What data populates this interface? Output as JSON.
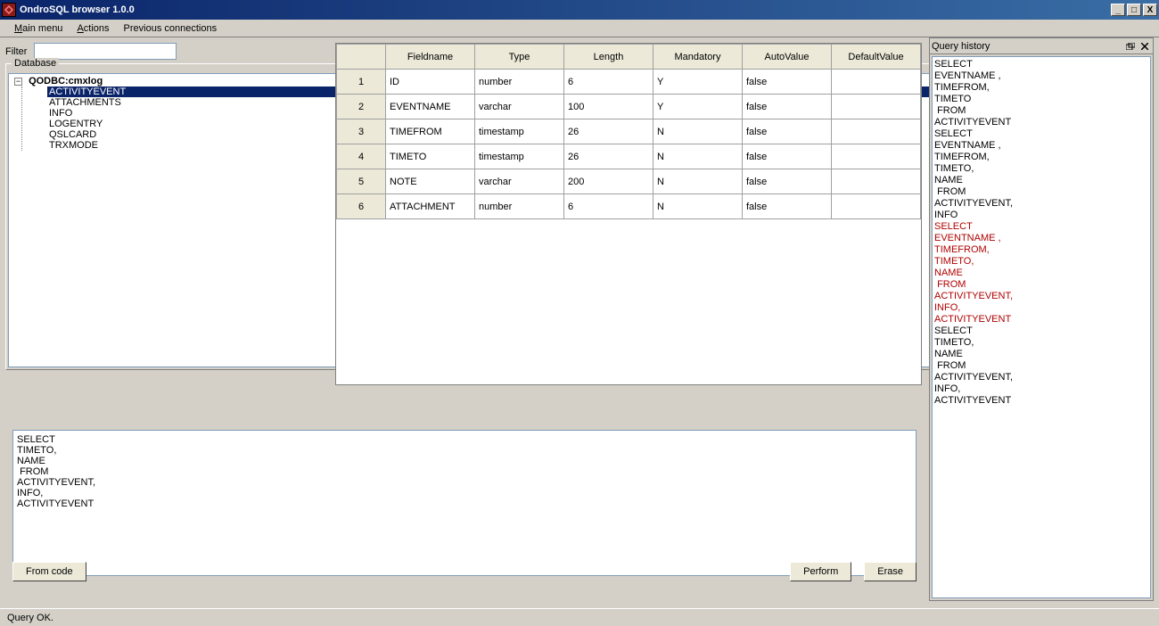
{
  "window": {
    "title": "OndroSQL browser 1.0.0"
  },
  "menu": {
    "main_menu": "Main menu",
    "actions": "Actions",
    "previous_connections": "Previous connections"
  },
  "filter": {
    "label": "Filter",
    "value": ""
  },
  "database": {
    "group_label": "Database",
    "root": "QODBC:cmxlog",
    "selected": "ACTIVITYEVENT",
    "children": [
      "ACTIVITYEVENT",
      "ATTACHMENTS",
      "INFO",
      "LOGENTRY",
      "QSLCARD",
      "TRXMODE"
    ]
  },
  "columns_table": {
    "headers": [
      "Fieldname",
      "Type",
      "Length",
      "Mandatory",
      "AutoValue",
      "DefaultValue"
    ],
    "rows": [
      {
        "n": "1",
        "fieldname": "ID",
        "type": "number",
        "length": "6",
        "mandatory": "Y",
        "autovalue": "false",
        "defaultvalue": ""
      },
      {
        "n": "2",
        "fieldname": "EVENTNAME",
        "type": "varchar",
        "length": "100",
        "mandatory": "Y",
        "autovalue": "false",
        "defaultvalue": ""
      },
      {
        "n": "3",
        "fieldname": "TIMEFROM",
        "type": "timestamp",
        "length": "26",
        "mandatory": "N",
        "autovalue": "false",
        "defaultvalue": ""
      },
      {
        "n": "4",
        "fieldname": "TIMETO",
        "type": "timestamp",
        "length": "26",
        "mandatory": "N",
        "autovalue": "false",
        "defaultvalue": ""
      },
      {
        "n": "5",
        "fieldname": "NOTE",
        "type": "varchar",
        "length": "200",
        "mandatory": "N",
        "autovalue": "false",
        "defaultvalue": ""
      },
      {
        "n": "6",
        "fieldname": "ATTACHMENT",
        "type": "number",
        "length": "6",
        "mandatory": "N",
        "autovalue": "false",
        "defaultvalue": ""
      }
    ]
  },
  "query": "SELECT\nTIMETO,\nNAME\n FROM\nACTIVITYEVENT,\nINFO,\nACTIVITYEVENT",
  "buttons": {
    "from_code": "From code",
    "perform": "Perform",
    "erase": "Erase"
  },
  "history": {
    "title": "Query history",
    "entries": [
      {
        "text": "SELECT\nEVENTNAME ,\nTIMEFROM,\nTIMETO\n FROM\nACTIVITYEVENT",
        "error": false
      },
      {
        "text": "SELECT\nEVENTNAME ,\nTIMEFROM,\nTIMETO,\nNAME\n FROM\nACTIVITYEVENT,\nINFO",
        "error": false
      },
      {
        "text": "SELECT\nEVENTNAME ,\nTIMEFROM,\nTIMETO,\nNAME\n FROM\nACTIVITYEVENT,\nINFO,\nACTIVITYEVENT",
        "error": true
      },
      {
        "text": "SELECT\nTIMETO,\nNAME\n FROM\nACTIVITYEVENT,\nINFO,\nACTIVITYEVENT",
        "error": false
      }
    ]
  },
  "status": "Query OK."
}
